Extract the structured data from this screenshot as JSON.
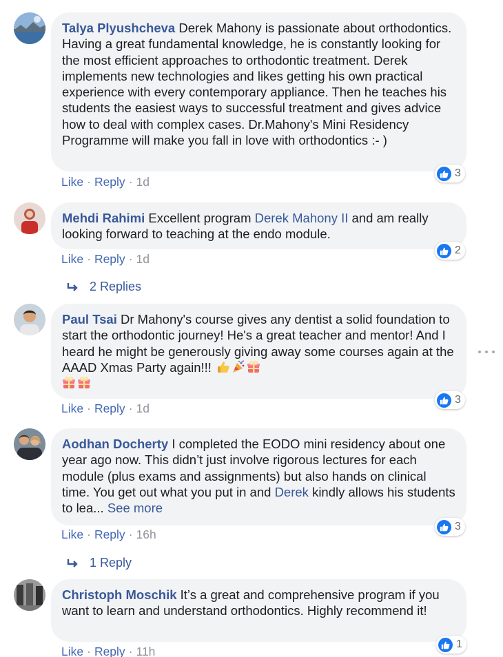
{
  "comments": [
    {
      "author": "Talya Plyushcheva",
      "text": "Derek Mahony is passionate about orthodontics. Having a great fundamental knowledge, he is constantly looking for the most efficient approaches to orthodontic treatment. Derek implements new technologies and likes getting his own practical experience with every contemporary appliance. Then he teaches his students the easiest ways to successful treatment and gives advice how to deal with complex cases. Dr.Mahony's Mini Residency Programme will make you fall in love with orthodontics :- )",
      "reactions": "3",
      "like": "Like",
      "reply": "Reply",
      "time": "1d"
    },
    {
      "author": "Mehdi Rahimi",
      "text_before": "Excellent program",
      "mention": "Derek Mahony II",
      "text_after": "and am really looking forward to teaching at the endo module.",
      "reactions": "2",
      "like": "Like",
      "reply": "Reply",
      "time": "1d",
      "replies_label": "2 Replies"
    },
    {
      "author": "Paul Tsai",
      "text": "Dr Mahony's course gives any dentist a solid foundation to start the orthodontic journey! He's a great teacher and mentor! And I heard he might be generously giving away some courses again at the AAAD Xmas Party again!!!",
      "reactions": "3",
      "like": "Like",
      "reply": "Reply",
      "time": "1d"
    },
    {
      "author": "Aodhan Docherty",
      "text_before": "I completed the EODO mini residency about one year ago now. This didn’t just involve rigorous lectures for each module (plus exams and assignments) but also hands on clinical time. You get out what you put in and",
      "mention": "Derek",
      "text_after": "kindly allows his students to lea...",
      "see_more": "See more",
      "reactions": "3",
      "like": "Like",
      "reply": "Reply",
      "time": "16h",
      "replies_label": "1 Reply"
    },
    {
      "author": "Christoph Moschik",
      "text": "It’s a great and comprehensive program if you want to learn and understand orthodontics. Highly recommend it!",
      "reactions": "1",
      "like": "Like",
      "reply": "Reply",
      "time": "11h"
    }
  ],
  "separator": "·",
  "colors": {
    "name_link": "#385898",
    "bubble_bg": "#f2f3f5",
    "like_blue": "#1877f2",
    "meta_gray": "#90949c"
  }
}
